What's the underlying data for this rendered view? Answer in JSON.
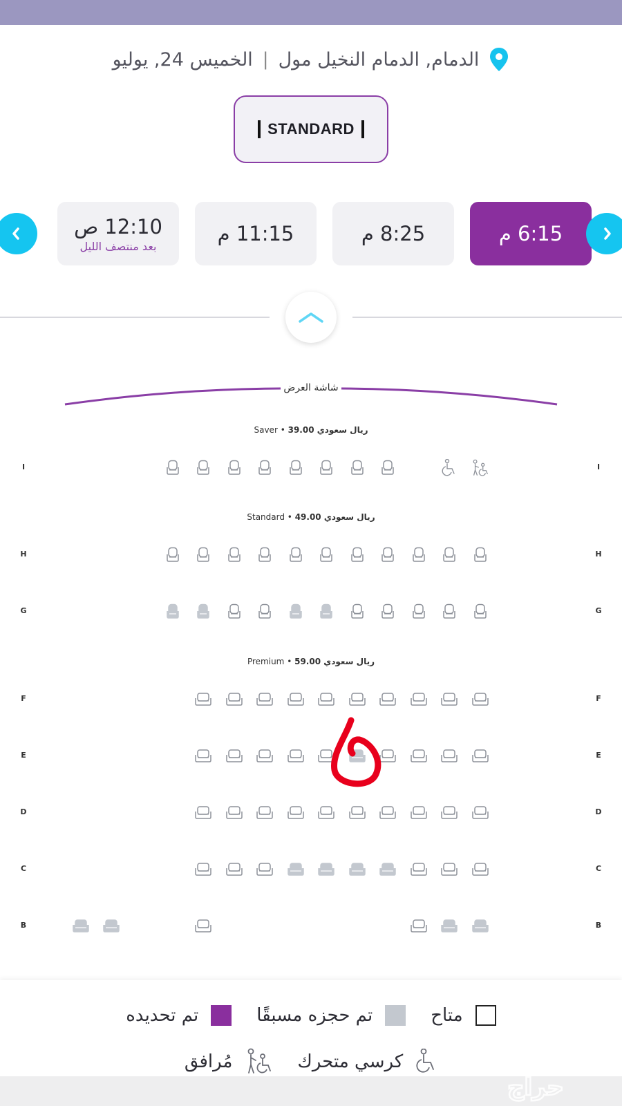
{
  "header": {
    "location": "الدمام, الدمام النخيل مول",
    "separator": "|",
    "date": "الخميس 24, يوليو",
    "format": "STANDARD",
    "pin_color": "#16c3ee"
  },
  "showtimes": [
    {
      "time": "6:15 م",
      "subtitle": "",
      "selected": true
    },
    {
      "time": "8:25 م",
      "subtitle": "",
      "selected": false
    },
    {
      "time": "11:15 م",
      "subtitle": "",
      "selected": false
    },
    {
      "time": "12:10 ص",
      "subtitle": "بعد منتصف الليل",
      "selected": false
    }
  ],
  "screen_label": "شاشة العرض",
  "tiers": {
    "saver": {
      "name": "Saver",
      "price": "ريال سعودي 39.00"
    },
    "standard": {
      "name": "Standard",
      "price": "ريال سعودي 49.00"
    },
    "premium": {
      "name": "Premium",
      "price": "ريال سعودي 59.00"
    }
  },
  "rows": [
    "I",
    "H",
    "G",
    "F",
    "E",
    "D",
    "C",
    "B"
  ],
  "legend": {
    "available": "متاح",
    "booked": "تم حجزه مسبقًا",
    "selected": "تم تحديده",
    "wheelchair": "كرسي متحرك",
    "companion": "مُرافق"
  },
  "colors": {
    "accent": "#8a2f9e",
    "nav_arrow": "#15c5f0",
    "booked_seat": "#c3c8cf",
    "available_seat_outline": "#8e929a",
    "marker": "#e8001c"
  },
  "watermark": "حراج"
}
